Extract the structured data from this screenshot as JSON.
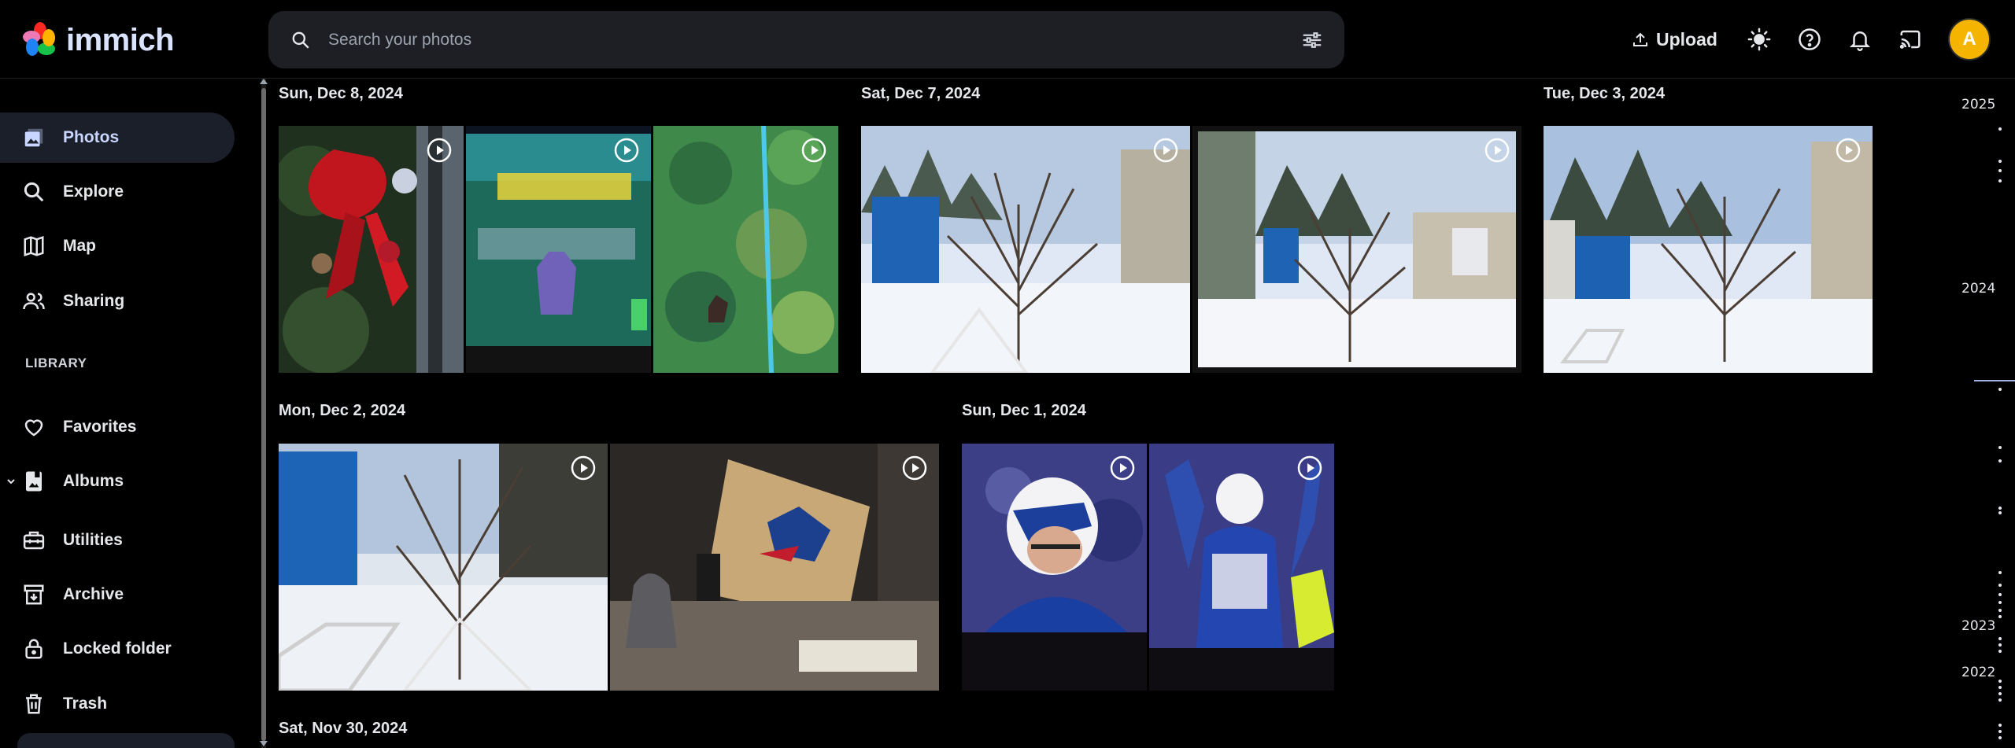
{
  "app": {
    "name": "immich"
  },
  "search": {
    "placeholder": "Search your photos"
  },
  "header": {
    "upload_label": "Upload",
    "avatar_initial": "A"
  },
  "sidebar": {
    "items": [
      {
        "label": "Photos",
        "icon": "photos-icon",
        "active": true
      },
      {
        "label": "Explore",
        "icon": "explore-icon"
      },
      {
        "label": "Map",
        "icon": "map-icon"
      },
      {
        "label": "Sharing",
        "icon": "sharing-icon"
      }
    ],
    "library_title": "LIBRARY",
    "library_items": [
      {
        "label": "Favorites",
        "icon": "heart-icon"
      },
      {
        "label": "Albums",
        "icon": "albums-icon"
      },
      {
        "label": "Utilities",
        "icon": "utilities-icon"
      },
      {
        "label": "Archive",
        "icon": "archive-icon"
      },
      {
        "label": "Locked folder",
        "icon": "lock-icon"
      },
      {
        "label": "Trash",
        "icon": "trash-icon"
      }
    ]
  },
  "timeline": {
    "groups": [
      {
        "date": "Sun, Dec 8, 2024"
      },
      {
        "date": "Sat, Dec 7, 2024"
      },
      {
        "date": "Tue, Dec 3, 2024"
      },
      {
        "date": "Mon, Dec 2, 2024"
      },
      {
        "date": "Sun, Dec 1, 2024"
      },
      {
        "date": "Sat, Nov 30, 2024"
      }
    ]
  },
  "scrubber": {
    "years": [
      "2025",
      "2024",
      "2023",
      "2022"
    ]
  },
  "colors": {
    "accent": "#9fb3e8",
    "avatar": "#f4b400",
    "background": "#000000",
    "search_bg": "#1d1f24"
  }
}
